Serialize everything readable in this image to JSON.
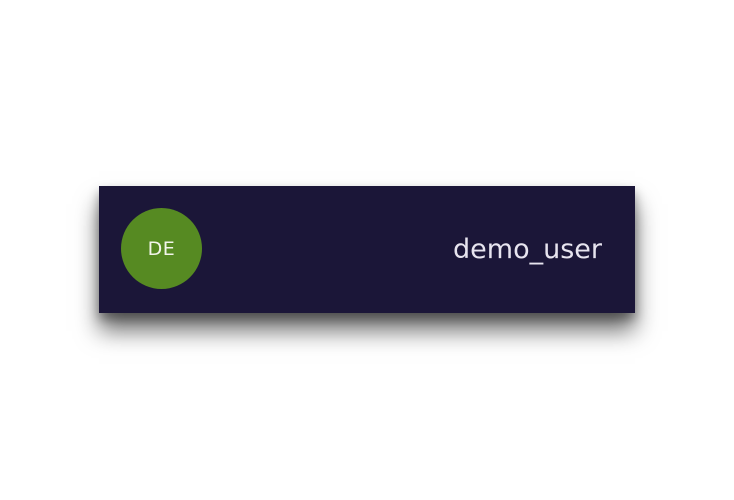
{
  "user_card": {
    "avatar_initials": "DE",
    "username": "demo_user"
  },
  "colors": {
    "card_background": "#1b1638",
    "avatar_background": "#568a22",
    "text": "#e7e4ef"
  }
}
